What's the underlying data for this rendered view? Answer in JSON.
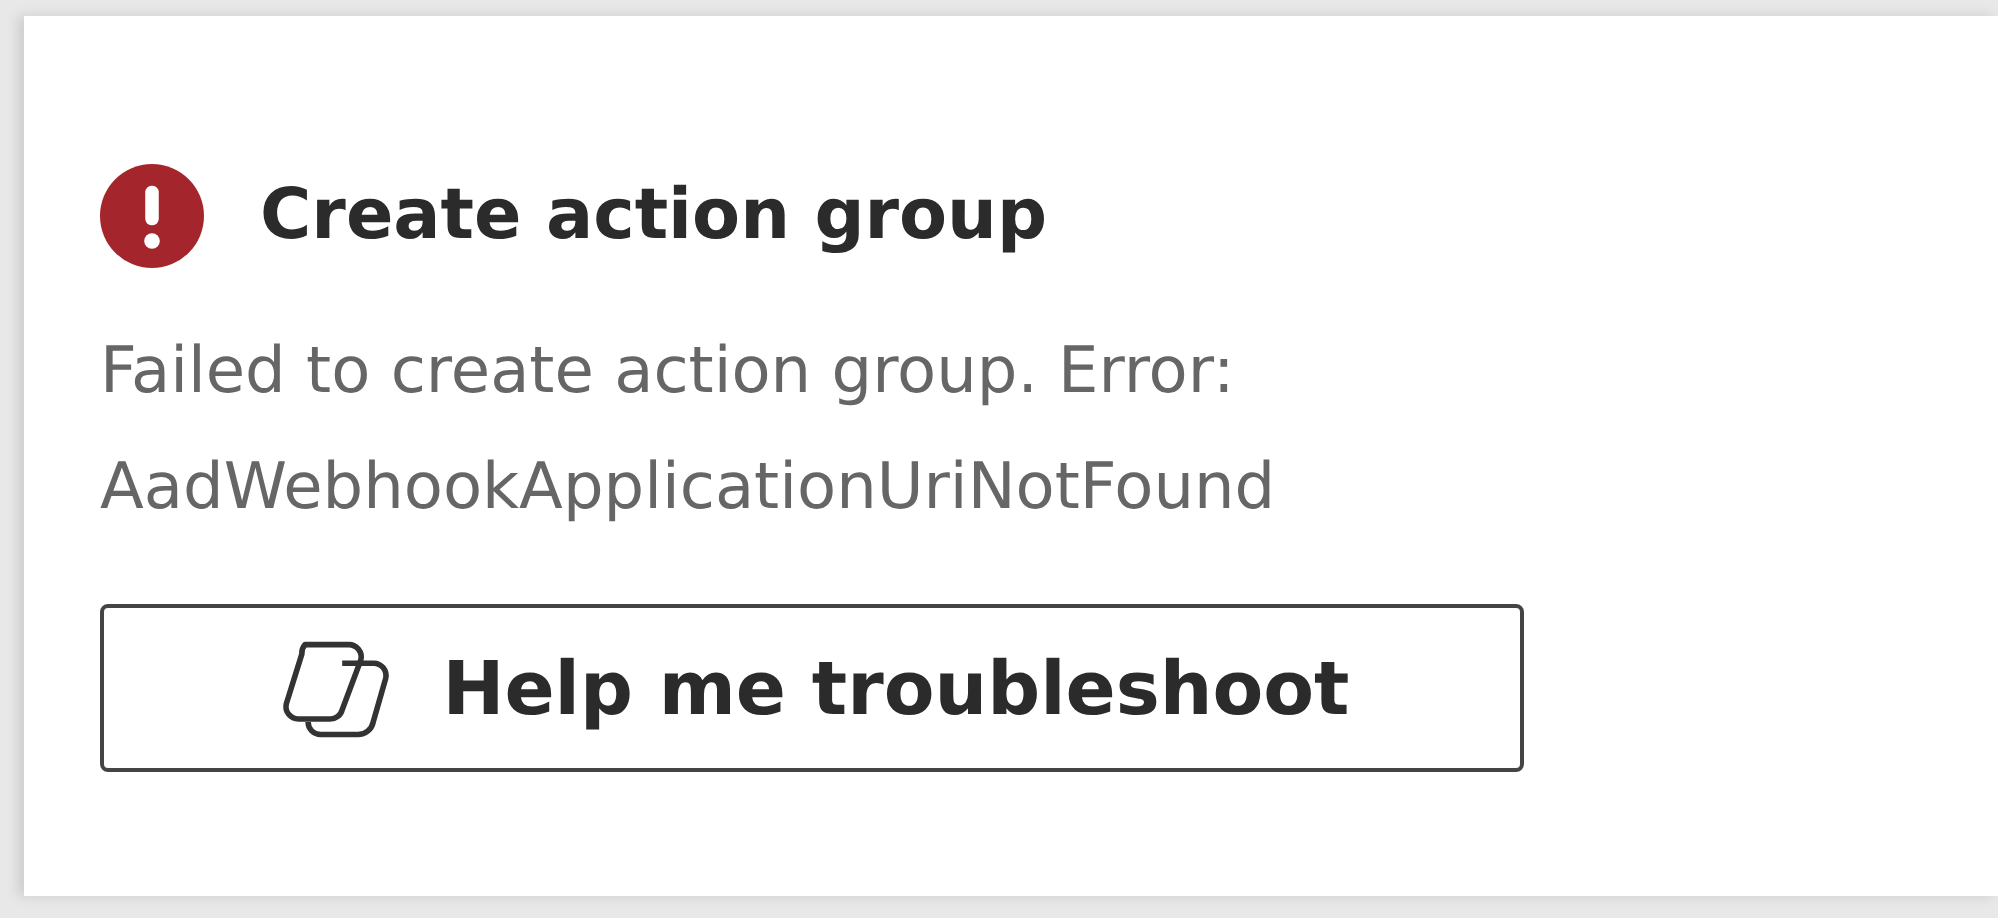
{
  "notification": {
    "kind": "error",
    "title": "Create action group",
    "message": [
      "Failed to create action group. Error:",
      "AadWebhookApplicationUriNotFound"
    ],
    "button": {
      "label": "Help me troubleshoot"
    }
  }
}
